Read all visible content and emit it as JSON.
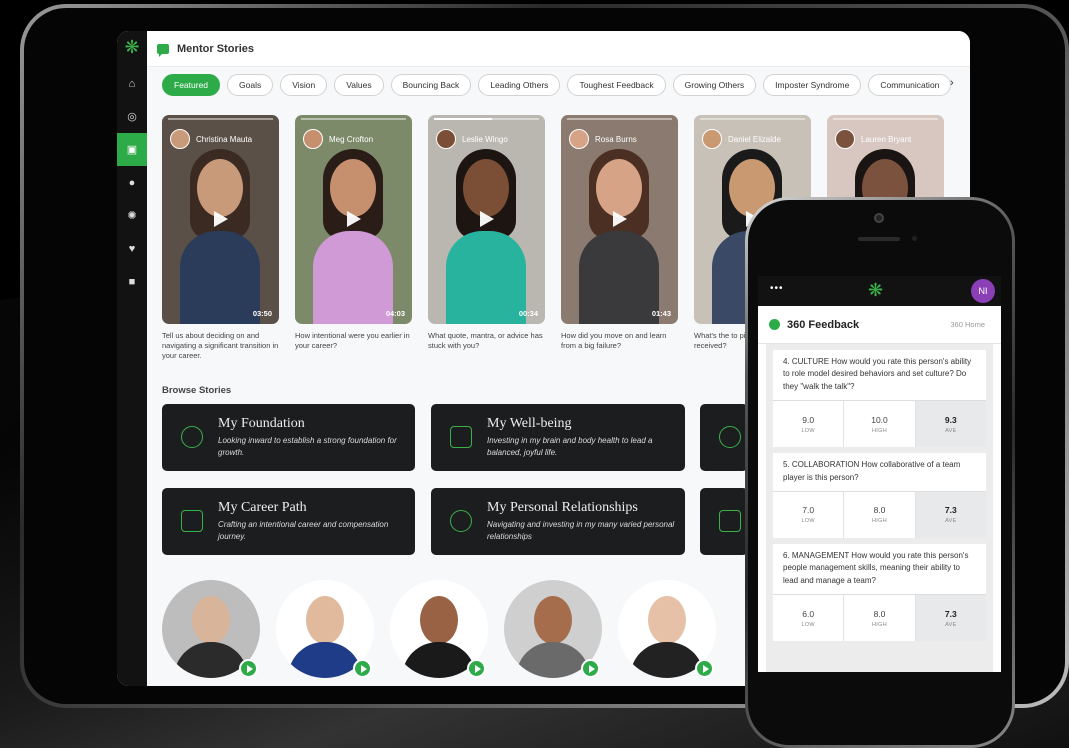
{
  "app": {
    "header_title": "Mentor Stories"
  },
  "chips": [
    "Featured",
    "Goals",
    "Vision",
    "Values",
    "Bouncing Back",
    "Leading Others",
    "Toughest Feedback",
    "Growing Others",
    "Imposter Syndrome",
    "Communication"
  ],
  "chips_more_icon": "chevron-right-icon",
  "sidebar_icons": [
    "logo-tree-icon",
    "home-icon",
    "spiral-icon",
    "chat-icon",
    "message-icon",
    "sun-icon",
    "heart-icon",
    "video-icon"
  ],
  "videos": [
    {
      "name": "Christina Mauta",
      "duration": "03:50",
      "question": "Tell us about deciding on and navigating a significant transition in your career.",
      "progress": 0,
      "bg": "#5a5048",
      "hair": "#3b2a22",
      "skin": "#c99a7a",
      "shirt": "#2b3b5a"
    },
    {
      "name": "Meg Crofton",
      "duration": "04:03",
      "question": "How intentional were you earlier in your career?",
      "progress": 0,
      "bg": "#7d8a6a",
      "hair": "#2a1c16",
      "skin": "#c6906f",
      "shirt": "#cf9ad6"
    },
    {
      "name": "Leslie Wingo",
      "duration": "00:34",
      "question": "What quote, mantra, or advice has stuck with you?",
      "progress": 0.55,
      "bg": "#b9b7b0",
      "hair": "#1d1512",
      "skin": "#7b4e36",
      "shirt": "#27b39d"
    },
    {
      "name": "Rosa Burns",
      "duration": "01:43",
      "question": "How did you move on and learn from a big failure?",
      "progress": 0,
      "bg": "#8a7a70",
      "hair": "#4a2f22",
      "skin": "#d6a386",
      "shirt": "#3a3a3c"
    },
    {
      "name": "Daniel Elizalde",
      "duration": "",
      "question": "What's the to piece of feedb received?",
      "progress": 0,
      "bg": "#c7c1b8",
      "hair": "#1a1a1a",
      "skin": "#c99a72",
      "shirt": "#3a4a66"
    },
    {
      "name": "Lauren Bryant",
      "duration": "",
      "question": "",
      "progress": 0,
      "bg": "#d7c7c0",
      "hair": "#1a1412",
      "skin": "#7b523d",
      "shirt": "#3a2e2a"
    }
  ],
  "browse_title": "Browse Stories",
  "cards": [
    {
      "title": "My Foundation",
      "desc": "Looking inward to establish a strong foundation for growth.",
      "icon": "atom-icon"
    },
    {
      "title": "My Well-being",
      "desc": "Investing in my brain and body health to lead a balanced, joyful life.",
      "icon": "head-brain-icon"
    },
    {
      "title": "",
      "desc": "",
      "icon": "plant-icon"
    },
    {
      "title": "My Career Path",
      "desc": "Crafting an intentional career and compensation journey.",
      "icon": "podium-icon"
    },
    {
      "title": "My Personal Relationships",
      "desc": "Navigating and investing in my many varied personal relationships",
      "icon": "hands-icon"
    },
    {
      "title": "",
      "desc": "",
      "icon": "mountain-icon"
    }
  ],
  "mentors": [
    {
      "skin": "#d8b49a",
      "shirt": "#2b2b2b",
      "bg": "#bdbdbd"
    },
    {
      "skin": "#e1b99d",
      "shirt": "#1f3c88",
      "bg": "#ffffff"
    },
    {
      "skin": "#9a6244",
      "shirt": "#1a1a1a",
      "bg": "#ffffff"
    },
    {
      "skin": "#a66d4d",
      "shirt": "#6a6a6a",
      "bg": "#cfcfcf"
    },
    {
      "skin": "#e6c1a7",
      "shirt": "#222222",
      "bg": "#ffffff"
    }
  ],
  "phone": {
    "menu_dots": "•••",
    "avatar_initials": "NI",
    "title": "360 Feedback",
    "home_link": "360 Home",
    "questions": [
      {
        "text": "4. CULTURE How would you rate this person's ability to role model desired behaviors and set culture? Do they \"walk the talk\"?",
        "low": "9.0",
        "high": "10.0",
        "ave": "9.3"
      },
      {
        "text": "5. COLLABORATION How collaborative of a team player is this person?",
        "low": "7.0",
        "high": "8.0",
        "ave": "7.3"
      },
      {
        "text": "6. MANAGEMENT How would you rate this person's people management skills, meaning their ability to lead and manage a team?",
        "low": "6.0",
        "high": "8.0",
        "ave": "7.3"
      }
    ],
    "score_labels": {
      "low": "LOW",
      "high": "HIGH",
      "ave": "AVE"
    }
  },
  "colors": {
    "accent": "#2eab49",
    "card_bg": "#1c1d1f",
    "rail_bg": "#121212"
  }
}
